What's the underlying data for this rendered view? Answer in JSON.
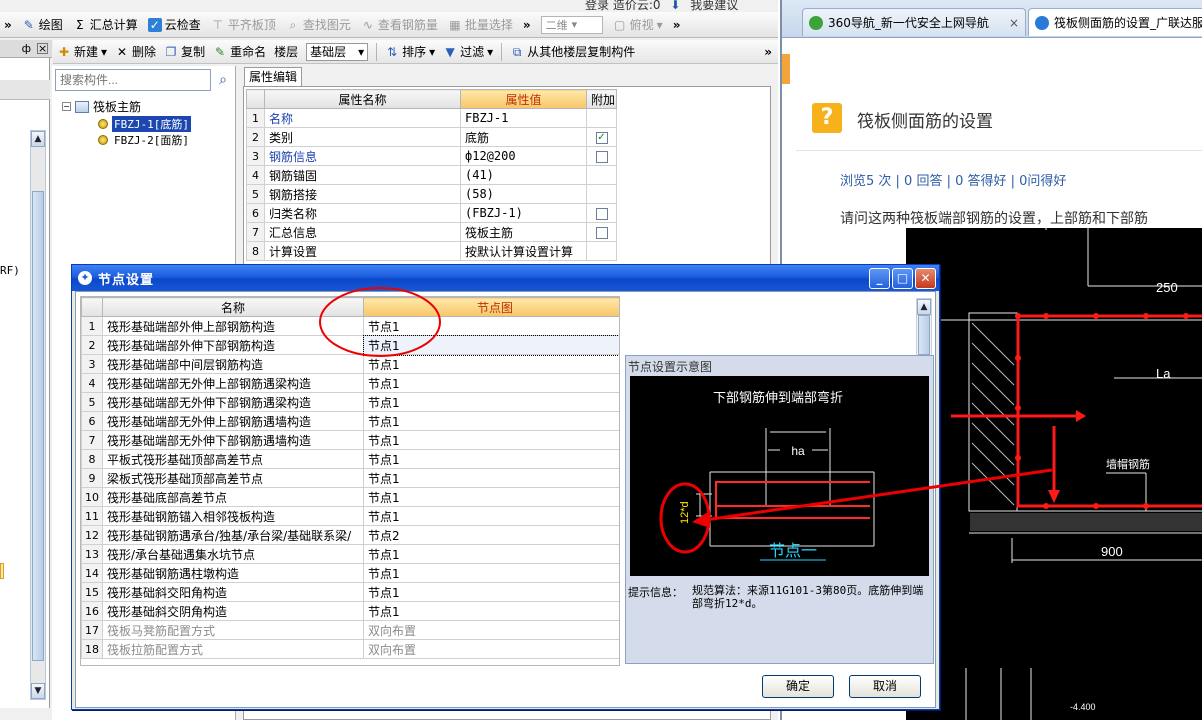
{
  "app": {
    "top_text": "登录  造价云:0",
    "top_text2": "我要建议",
    "toolbar1": {
      "items": [
        {
          "label": "绘图",
          "icon": "pencil-icon"
        },
        {
          "label": "汇总计算",
          "icon": "sigma-icon"
        },
        {
          "label": "云检查",
          "icon": "cloud-check-icon"
        },
        {
          "label": "平齐板顶",
          "icon": "align-top-icon"
        },
        {
          "label": "查找图元",
          "icon": "find-icon"
        },
        {
          "label": "查看钢筋量",
          "icon": "rebar-view-icon"
        },
        {
          "label": "批量选择",
          "icon": "batch-select-icon"
        }
      ],
      "view_combo": "二维",
      "view_button": "俯视"
    },
    "dock": {
      "pin": "ф",
      "close": "×"
    },
    "toolbar2": {
      "new": "新建",
      "delete": "删除",
      "copy": "复制",
      "rename": "重命名",
      "floor_label": "楼层",
      "floor_value": "基础层",
      "sort": "排序",
      "filter": "过滤",
      "copy_from_floor": "从其他楼层复制构件"
    },
    "tree": {
      "search_placeholder": "搜索构件...",
      "root": "筏板主筋",
      "items": [
        "FBZJ-1[底筋]",
        "FBZJ-2[面筋]"
      ],
      "left_fragment": "RF)"
    },
    "properties": {
      "tab": "属性编辑",
      "headers": [
        "属性名称",
        "属性值",
        "附加"
      ],
      "rows": [
        {
          "no": "1",
          "name": "名称",
          "value": "FBZJ-1",
          "check": ""
        },
        {
          "no": "2",
          "name": "类别",
          "value": "底筋",
          "check": "checked"
        },
        {
          "no": "3",
          "name": "钢筋信息",
          "value": "ф12@200",
          "check": "unchecked"
        },
        {
          "no": "4",
          "name": "钢筋锚固",
          "value": "(41)",
          "check": ""
        },
        {
          "no": "5",
          "name": "钢筋搭接",
          "value": "(58)",
          "check": ""
        },
        {
          "no": "6",
          "name": "归类名称",
          "value": "(FBZJ-1)",
          "check": "unchecked"
        },
        {
          "no": "7",
          "name": "汇总信息",
          "value": "筏板主筋",
          "check": "unchecked"
        },
        {
          "no": "8",
          "name": "计算设置",
          "value": "按默认计算设置计算",
          "check": ""
        }
      ]
    }
  },
  "dialog": {
    "title": "节点设置",
    "headers": [
      "名称",
      "节点图"
    ],
    "rows": [
      {
        "no": "1",
        "name": "筏形基础端部外伸上部钢筋构造",
        "value": "节点1",
        "gray": false
      },
      {
        "no": "2",
        "name": "筏形基础端部外伸下部钢筋构造",
        "value": "节点1",
        "gray": false
      },
      {
        "no": "3",
        "name": "筏形基础端部中间层钢筋构造",
        "value": "节点1",
        "gray": false
      },
      {
        "no": "4",
        "name": "筏形基础端部无外伸上部钢筋遇梁构造",
        "value": "节点1",
        "gray": false
      },
      {
        "no": "5",
        "name": "筏形基础端部无外伸下部钢筋遇梁构造",
        "value": "节点1",
        "gray": false
      },
      {
        "no": "6",
        "name": "筏形基础端部无外伸上部钢筋遇墙构造",
        "value": "节点1",
        "gray": false
      },
      {
        "no": "7",
        "name": "筏形基础端部无外伸下部钢筋遇墙构造",
        "value": "节点1",
        "gray": false
      },
      {
        "no": "8",
        "name": "平板式筏形基础顶部高差节点",
        "value": "节点1",
        "gray": false
      },
      {
        "no": "9",
        "name": "梁板式筏形基础顶部高差节点",
        "value": "节点1",
        "gray": false
      },
      {
        "no": "10",
        "name": "筏形基础底部高差节点",
        "value": "节点1",
        "gray": false
      },
      {
        "no": "11",
        "name": "筏形基础钢筋锚入相邻筏板构造",
        "value": "节点1",
        "gray": false
      },
      {
        "no": "12",
        "name": "筏形基础钢筋遇承台/独基/承台梁/基础联系梁/",
        "value": "节点2",
        "gray": false
      },
      {
        "no": "13",
        "name": "筏形/承台基础遇集水坑节点",
        "value": "节点1",
        "gray": false
      },
      {
        "no": "14",
        "name": "筏形基础钢筋遇柱墩构造",
        "value": "节点1",
        "gray": false
      },
      {
        "no": "15",
        "name": "筏形基础斜交阳角构造",
        "value": "节点1",
        "gray": false
      },
      {
        "no": "16",
        "name": "筏形基础斜交阴角构造",
        "value": "节点1",
        "gray": false
      },
      {
        "no": "17",
        "name": "筏板马凳筋配置方式",
        "value": "双向布置",
        "gray": true
      },
      {
        "no": "18",
        "name": "筏板拉筋配置方式",
        "value": "双向布置",
        "gray": true
      }
    ],
    "selected_row": 2,
    "preview": {
      "title": "节点设置示意图",
      "diagram_title": "下部钢筋伸到端部弯折",
      "ha_label": "ha",
      "bend_label": "12*d",
      "node_label": "节点一",
      "hint_label": "提示信息：",
      "hint_text": "规范算法：来源11G101-3第80页。底筋伸到端部弯折12*d。"
    },
    "ok": "确定",
    "cancel": "取消"
  },
  "browser": {
    "tabs": [
      {
        "label": "360导航_新一代安全上网导航",
        "close": "×",
        "icon_color": "#3aa33a"
      },
      {
        "label": "筏板侧面筋的设置_广联达服务",
        "icon_color": "#2a7ad8"
      }
    ],
    "question": {
      "icon": "?",
      "title": "筏板侧面筋的设置",
      "stats": "浏览5 次 | 0 回答 | 0 答得好 | 0问得好",
      "body": "请问这两种筏板端部钢筋的设置，上部筋和下部筋"
    },
    "cad": {
      "dim_250": "250",
      "la": "La",
      "cap_rebar": "墙帽钢筋",
      "dim_900": "900",
      "elev": "-4.400"
    }
  }
}
